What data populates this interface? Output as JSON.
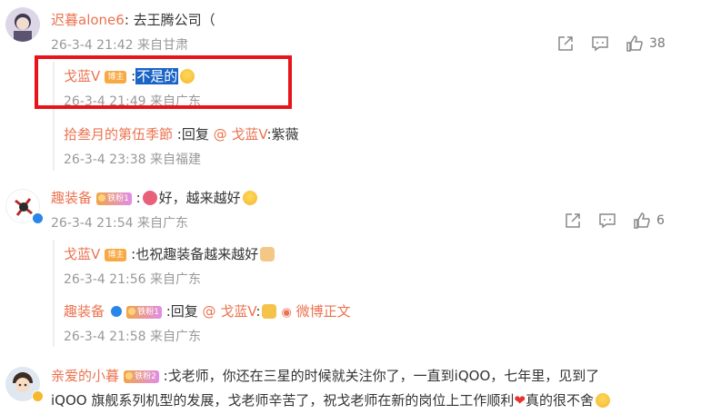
{
  "comments": [
    {
      "user": "迟暮alone6",
      "sep": ": ",
      "text": "去王腾公司（",
      "time": "26-3-4 21:42 来自甘肃",
      "likes": "38",
      "replies": [
        {
          "user": "戈蓝V",
          "badge": "博主",
          "sep": " :",
          "text": "不是的",
          "time": "26-3-4 21:49 来自广东"
        },
        {
          "user": "拾叁月的第伍季節",
          "sep": " :",
          "text": "回复 ",
          "mention": "@ 戈蓝V",
          "text2": ":紫薇",
          "time": "26-3-4 23:38 来自福建"
        }
      ]
    },
    {
      "user": "趣装备",
      "badge": "铁粉1",
      "sep": " :",
      "text": "好，越来越好",
      "time": "26-3-4 21:54 来自广东",
      "likes": "6",
      "replies": [
        {
          "user": "戈蓝V",
          "badge": "博主",
          "sep": " :",
          "text": "也祝趣装备越来越好",
          "time": "26-3-4 21:56 来自广东"
        },
        {
          "user": "趣装备",
          "badge": "铁粉1",
          "sep": " :",
          "text": "回复 ",
          "mention": "@ 戈蓝V",
          "text2": ":",
          "link": "微博正文",
          "time": "26-3-4 21:58 来自广东"
        }
      ]
    },
    {
      "user": "亲爱的小暮",
      "badge": "铁粉2",
      "sep": " :",
      "text": "戈老师，你还在三星的时候就关注你了，一直到iQOO，七年里，见到了",
      "text_line2": "iQOO 旗舰系列机型的发展，戈老师辛苦了，祝戈老师在新的岗位上工作顺利",
      "text_line2_end": "真的很不舍"
    }
  ],
  "colors": {
    "name": "#eb7350",
    "highlight_box": "#e8141b",
    "selection": "#1a64c8"
  },
  "icons": [
    "share-icon",
    "comment-icon",
    "like-icon",
    "verified-icon",
    "heart-icon",
    "crying-emoji-icon"
  ]
}
